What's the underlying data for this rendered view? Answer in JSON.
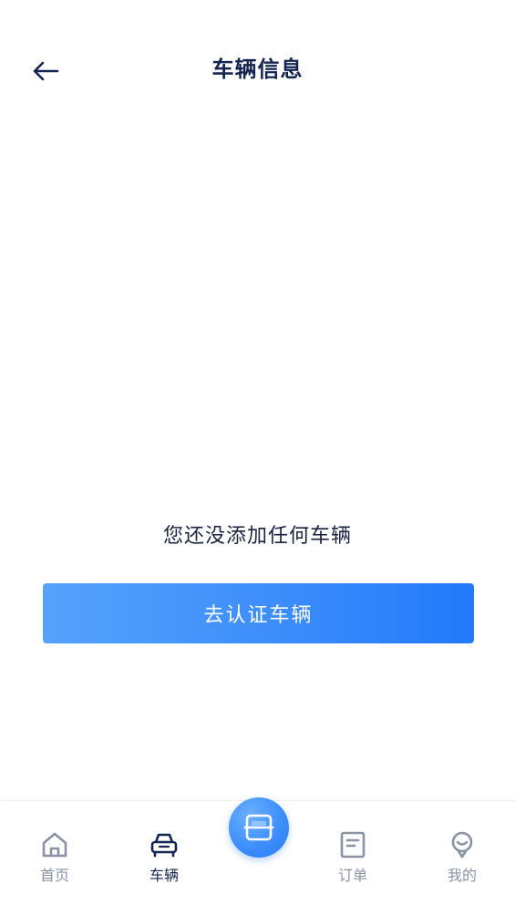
{
  "header": {
    "title": "车辆信息",
    "back_icon": "arrow-left-icon"
  },
  "empty_state": {
    "message": "您还没添加任何车辆",
    "button_label": "去认证车辆"
  },
  "tabbar": {
    "items": [
      {
        "label": "首页",
        "icon": "home-icon",
        "active": false
      },
      {
        "label": "车辆",
        "icon": "car-icon",
        "active": true
      },
      {
        "label": "订单",
        "icon": "order-icon",
        "active": false
      },
      {
        "label": "我的",
        "icon": "profile-icon",
        "active": false
      }
    ],
    "center_icon": "scan-icon"
  },
  "colors": {
    "title": "#142451",
    "accent": "#3c8dfb",
    "tab_inactive": "#8a93a6",
    "tab_active": "#152552"
  }
}
